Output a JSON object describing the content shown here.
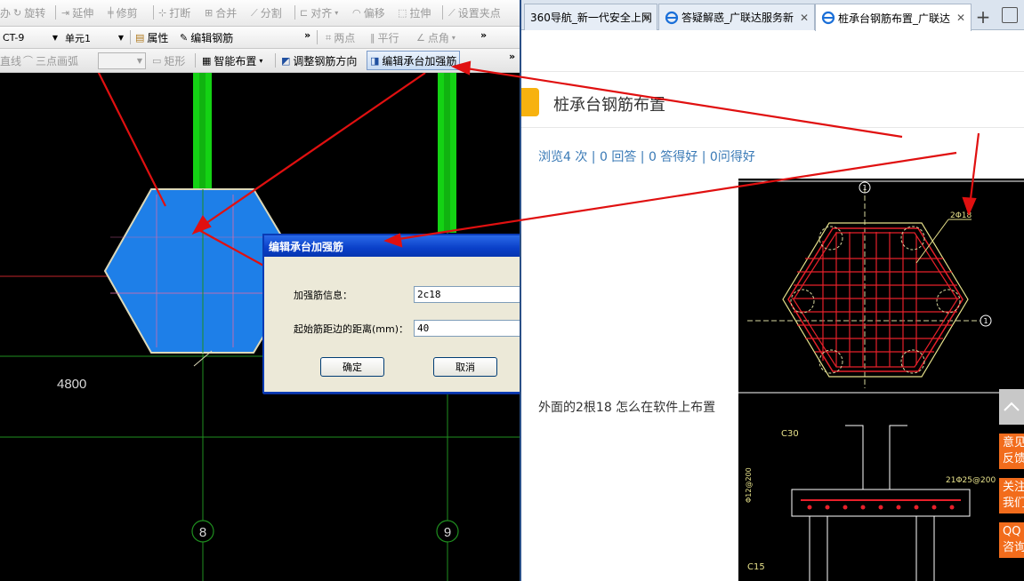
{
  "app": {
    "toolbar1": [
      {
        "icon": "rotate-icon",
        "label": "旋转"
      },
      {
        "icon": "extend-icon",
        "label": "延伸"
      },
      {
        "icon": "trim-icon",
        "label": "修剪"
      },
      {
        "icon": "break-icon",
        "label": "打断"
      },
      {
        "icon": "merge-icon",
        "label": "合并"
      },
      {
        "icon": "split-icon",
        "label": "分割"
      },
      {
        "icon": "align-icon",
        "label": "对齐"
      },
      {
        "icon": "offset-icon",
        "label": "偏移"
      },
      {
        "icon": "stretch-icon",
        "label": "拉伸"
      },
      {
        "icon": "set-grip-icon",
        "label": "设置夹点"
      }
    ],
    "toolbar1_prefix": "办",
    "component_select": "CT-9",
    "unit_select": "单元1",
    "properties_label": "属性",
    "edit_rebar_label": "编辑钢筋",
    "two_points_label": "两点",
    "parallel_label": "平行",
    "point_angle_label": "点角",
    "straight_line_label": "直线",
    "three_point_arc_label": "三点画弧",
    "rectangle_label": "矩形",
    "smart_layout_label": "智能布置",
    "adjust_direction_label": "调整钢筋方向",
    "edit_cap_reinf_label": "编辑承台加强筋",
    "canvas": {
      "dim_text": "4800",
      "axis_8": "8",
      "axis_9": "9",
      "colors": {
        "cap": "#1e7fe8",
        "column": "#14d214",
        "grid": "#1f8f1f",
        "axis_red": "#d41b1b",
        "arrow": "#e01010"
      }
    },
    "dialog": {
      "title": "编辑承台加强筋",
      "close": "✕",
      "rebar_info_label": "加强筋信息：",
      "rebar_info_value": "2c18",
      "offset_label": "起始筋距边的距离(mm)：",
      "offset_value": "40",
      "ok_label": "确定",
      "cancel_label": "取消"
    }
  },
  "browser": {
    "tabs": [
      {
        "label": "360导航_新一代安全上网"
      },
      {
        "label": "答疑解惑_广联达服务新"
      },
      {
        "label": "桩承台钢筋布置_广联达",
        "active": true
      }
    ],
    "new_tab": "+",
    "question_title": "桩承台钢筋布置",
    "stats": "浏览4 次 | 0 回答 | 0 答得好 | 0问得好",
    "question_body": "外面的2根18 怎么在软件上布置",
    "drawing": {
      "axis_1_top": "1",
      "axis_1_side": "1",
      "rebar_label": "2Φ18",
      "c30": "C30",
      "c15": "C15",
      "rebar_spacing": "21Φ25@200",
      "side_rebar": "Φ12@200"
    },
    "side_buttons": [
      {
        "label": "意见反馈"
      },
      {
        "label": "关注我们"
      },
      {
        "label": "QQ咨询"
      }
    ],
    "scroll_top_icon": "chevron-up-icon"
  }
}
